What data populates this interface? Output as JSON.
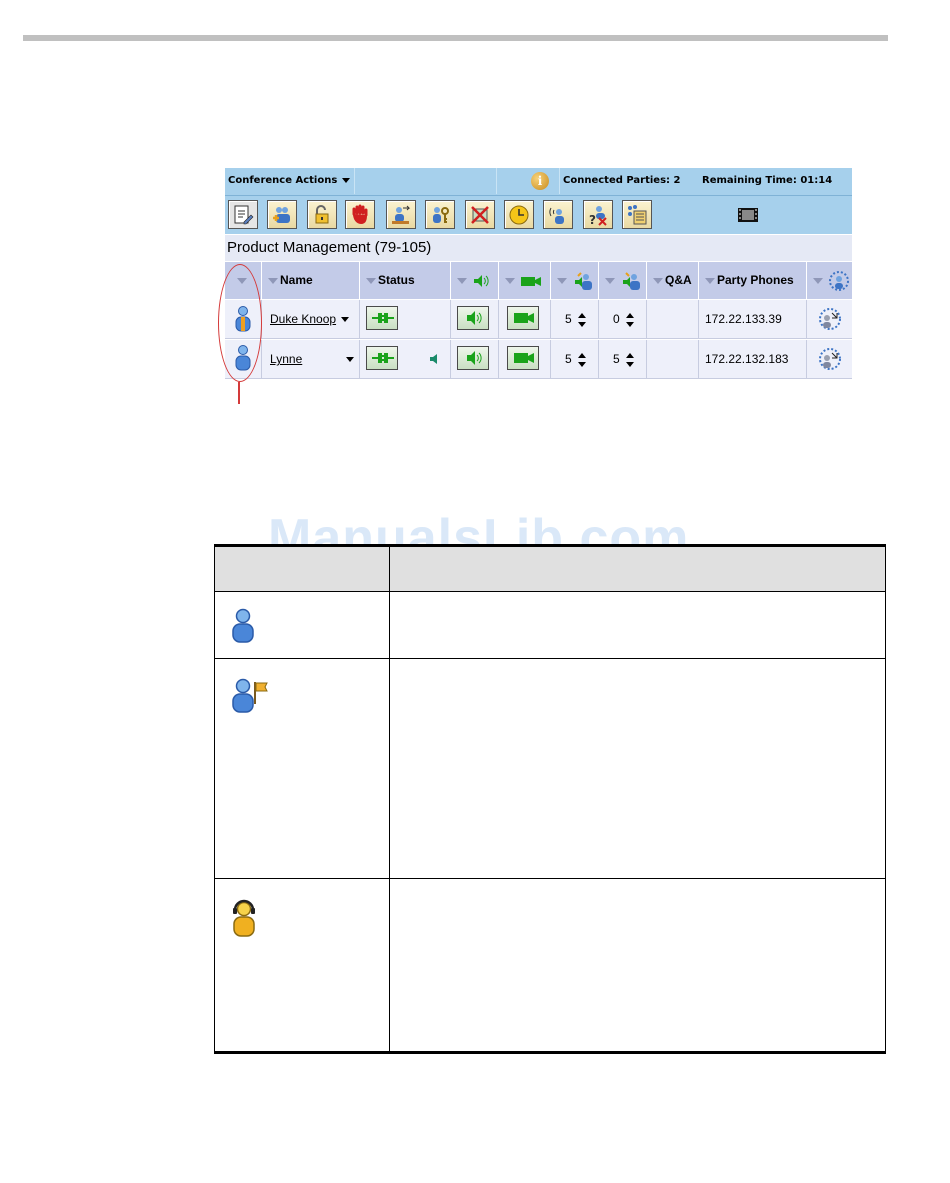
{
  "conference_actions": {
    "label": "Conference Actions"
  },
  "status_bar": {
    "info_icon": "info-icon",
    "connected_parties": "Connected Parties: 2",
    "remaining_time": "Remaining Time: 01:14"
  },
  "toolbar": {
    "icons": [
      "edit-properties-icon",
      "add-participants-icon",
      "lock-icon",
      "stop-hand-icon",
      "move-participant-icon",
      "participant-key-icon",
      "disconnect-icon",
      "clock-icon",
      "broadcast-participant-icon",
      "help-participant-icon",
      "layout-icon",
      "film-icon"
    ]
  },
  "conference": {
    "title": "Product Management (79-105)"
  },
  "table": {
    "columns": {
      "name": "Name",
      "status": "Status",
      "qa": "Q&A",
      "party_phones": "Party Phones"
    },
    "rows": [
      {
        "participant_icon": "chairperson-icon",
        "name": "Duke Knoop",
        "listen_volume": "5",
        "broadcast_volume": "0",
        "party_phone": "172.22.133.39",
        "speaking": false
      },
      {
        "participant_icon": "participant-icon",
        "name": "Lynne",
        "listen_volume": "5",
        "broadcast_volume": "5",
        "party_phone": "172.22.132.183",
        "speaking": true
      }
    ]
  },
  "watermark": "ManualsLib.com",
  "colors": {
    "toolbar_bg": "#a6d0ec",
    "header_bg": "#c3cbe8",
    "row_bg": "#eef0fa",
    "highlight": "#d43a3a"
  }
}
